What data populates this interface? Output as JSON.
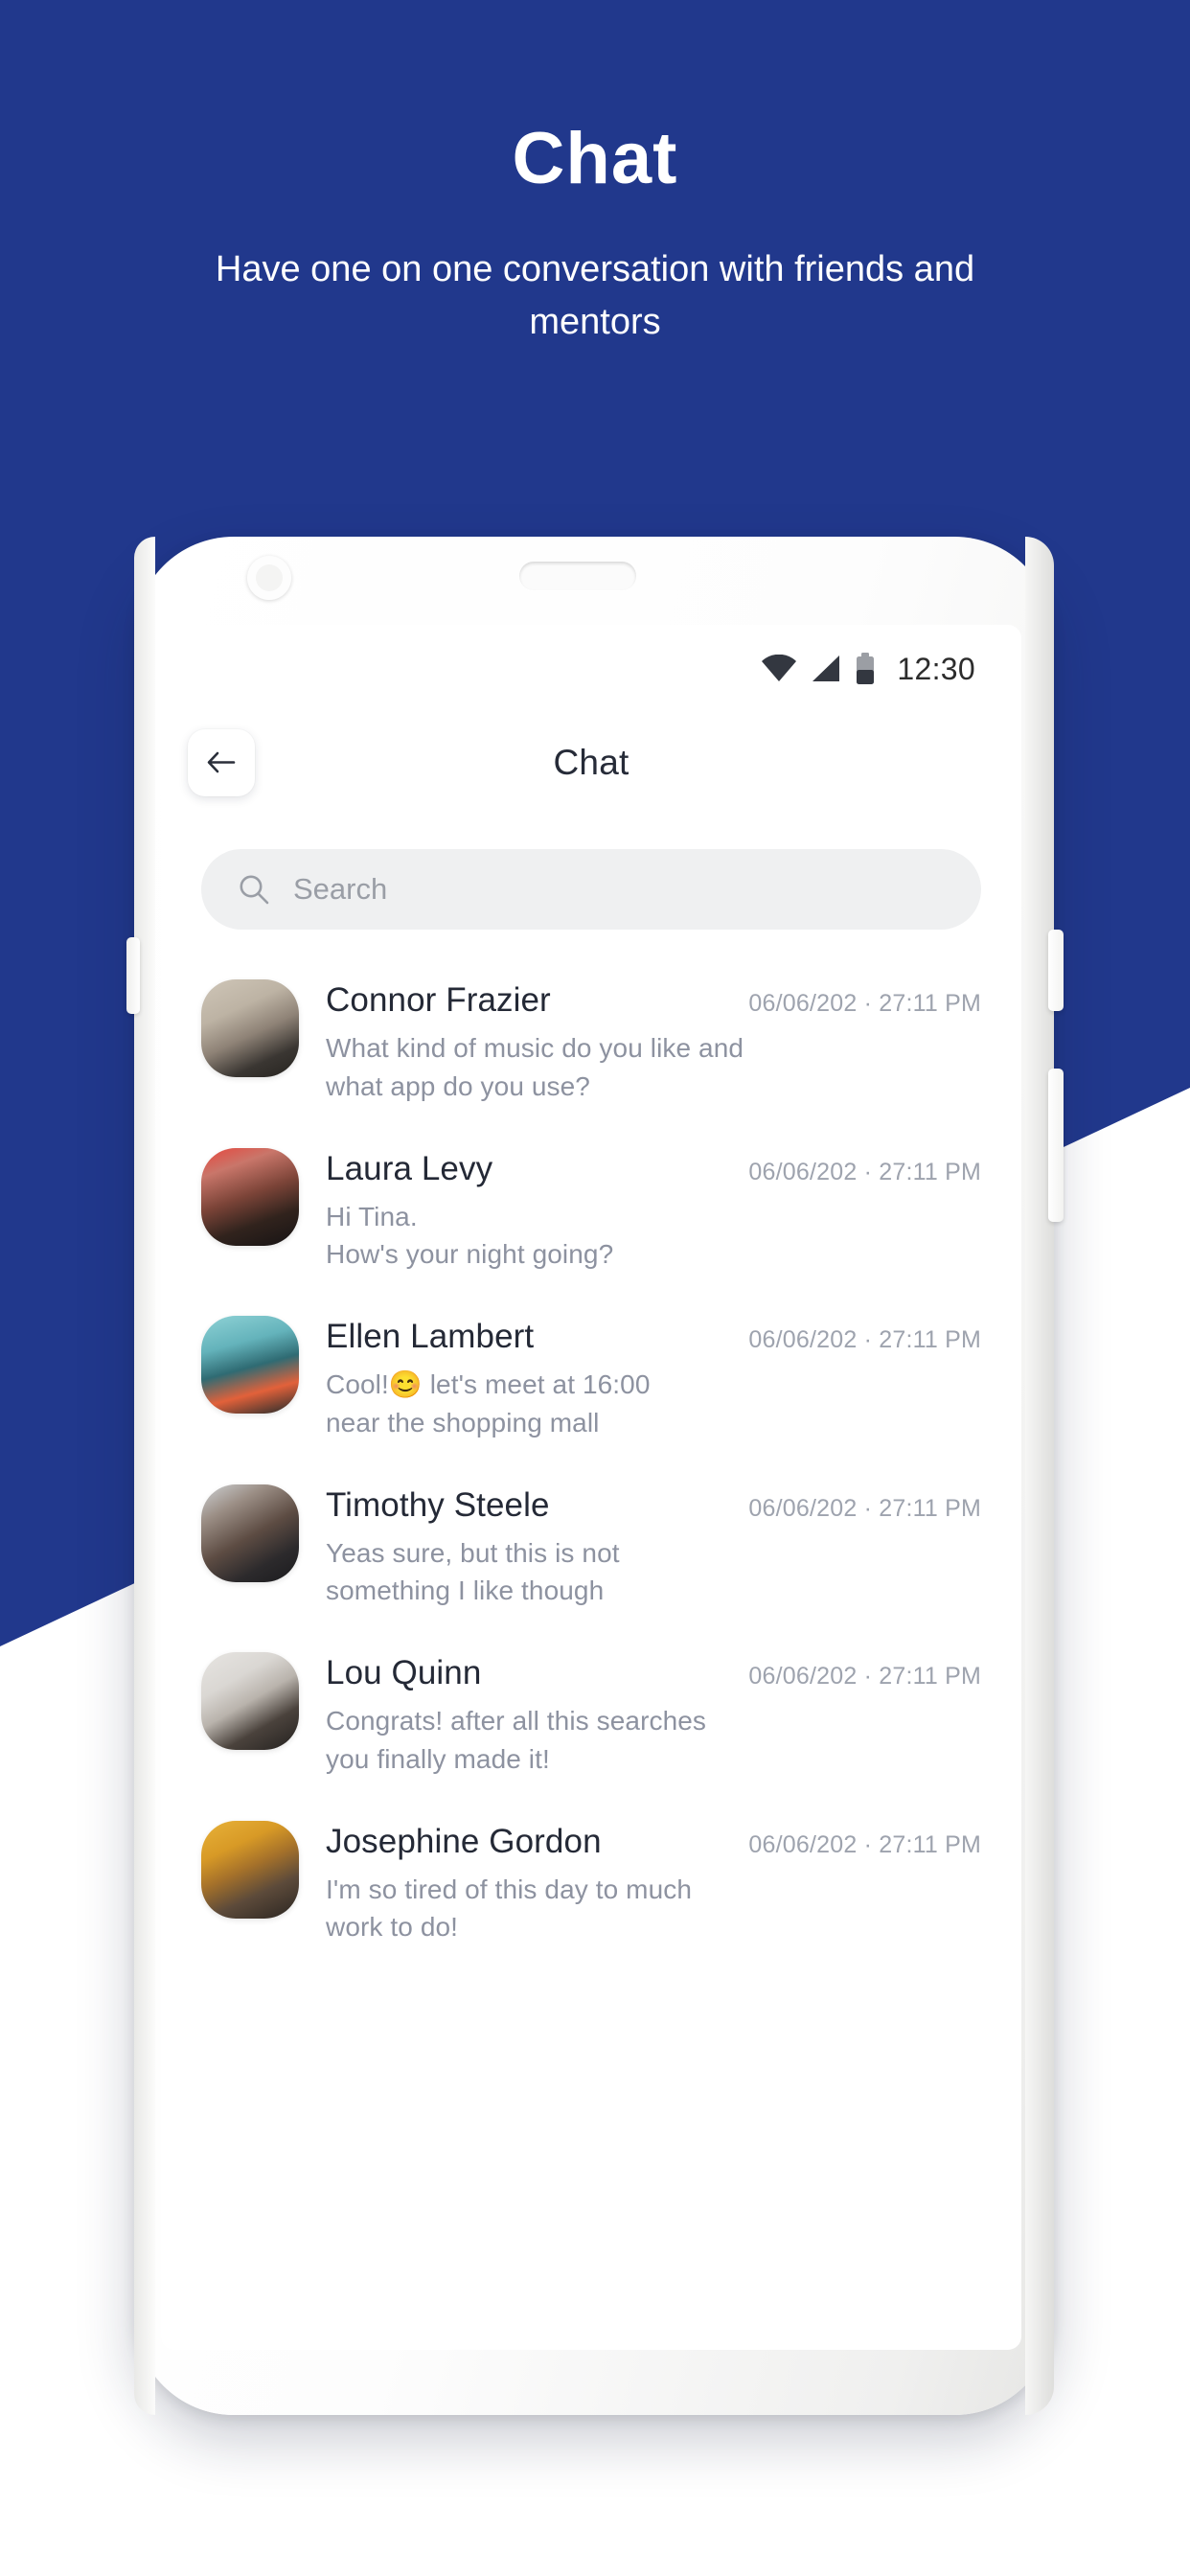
{
  "promo": {
    "title": "Chat",
    "subtitle": "Have one on one conversation with friends and mentors"
  },
  "colors": {
    "backdrop_blue": "#21388C",
    "name_text": "#242936",
    "message_text": "#8d92a0",
    "timestamp_text": "#9ea3ae",
    "search_bg": "#eff0f1",
    "phone_body": "#ffffff"
  },
  "phone": {
    "hardware": {
      "camera": "camera-lens",
      "speaker": "earpiece-speaker",
      "buttons": [
        "power-button",
        "volume-rocker",
        "volume-rocker-left"
      ]
    },
    "statusbar": {
      "wifi_icon": "wifi-icon",
      "signal_icon": "cellular-signal-icon",
      "battery_icon": "battery-icon",
      "time": "12:30"
    },
    "appbar": {
      "back_icon": "arrow-left-icon",
      "title": "Chat"
    },
    "search": {
      "icon": "search-icon",
      "placeholder": "Search",
      "value": ""
    }
  },
  "chats": [
    {
      "name": "Connor Frazier",
      "time": "06/06/202 · 27:11 PM",
      "message": "What kind of music do you like and\nwhat app do you use?",
      "avatar": "avatar-connor-frazier"
    },
    {
      "name": "Laura Levy",
      "time": "06/06/202 · 27:11 PM",
      "message": "Hi Tina.\nHow's your night going?",
      "avatar": "avatar-laura-levy"
    },
    {
      "name": "Ellen Lambert",
      "time": "06/06/202 · 27:11 PM",
      "message": "Cool!😊 let's meet at 16:00\nnear the shopping mall",
      "avatar": "avatar-ellen-lambert"
    },
    {
      "name": "Timothy Steele",
      "time": "06/06/202 · 27:11 PM",
      "message": "Yeas sure, but this is not\nsomething I like though",
      "avatar": "avatar-timothy-steele"
    },
    {
      "name": "Lou Quinn",
      "time": "06/06/202 · 27:11 PM",
      "message": "Congrats! after all this searches\nyou finally made it!",
      "avatar": "avatar-lou-quinn"
    },
    {
      "name": "Josephine Gordon",
      "time": "06/06/202 · 27:11 PM",
      "message": "I'm so tired of this day to much\nwork to do!",
      "avatar": "avatar-josephine-gordon"
    }
  ]
}
